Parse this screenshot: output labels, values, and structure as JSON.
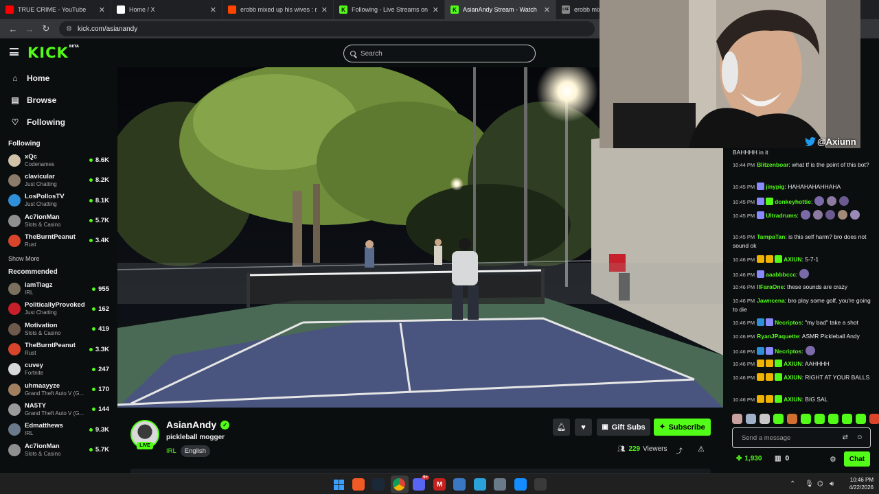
{
  "browser": {
    "tabs": [
      {
        "title": "TRUE CRIME - YouTube",
        "icon": "youtube-icon",
        "color": "#ff0000"
      },
      {
        "title": "Home / X",
        "icon": "x-icon",
        "color": "#ffffff"
      },
      {
        "title": "erobb mixed up his wives : r/Liv",
        "icon": "reddit-icon",
        "color": "#ff4500"
      },
      {
        "title": "Following - Live Streams on Kick",
        "icon": "kick-icon",
        "color": "#53fc18"
      },
      {
        "title": "AsianAndy Stream - Watch",
        "icon": "kick-icon",
        "color": "#53fc18"
      },
      {
        "title": "erobb mixed u",
        "icon": "lsf-icon",
        "color": "#888888"
      }
    ],
    "favicon_letters": {
      "kick": "K",
      "lsf": "LSF"
    },
    "url": "kick.com/asianandy"
  },
  "header": {
    "logo": "KICK",
    "logo_badge": "BETA",
    "search_placeholder": "Search"
  },
  "sidebar": {
    "nav": [
      {
        "label": "Home",
        "icon": "home-icon",
        "glyph": "⌂"
      },
      {
        "label": "Browse",
        "icon": "browse-icon",
        "glyph": "▤"
      },
      {
        "label": "Following",
        "icon": "heart-icon",
        "glyph": "♡"
      }
    ],
    "following_title": "Following",
    "following": [
      {
        "name": "xQc",
        "category": "Codenames",
        "viewers": "8.6K",
        "color": "#d2c3a8"
      },
      {
        "name": "clavicular",
        "category": "Just Chatting",
        "viewers": "8.2K",
        "color": "#8c7a6a"
      },
      {
        "name": "LosPollosTV",
        "category": "Just Chatting",
        "viewers": "8.1K",
        "color": "#2f8fd8"
      },
      {
        "name": "Ac7ionMan",
        "category": "Slots & Casino",
        "viewers": "5.7K",
        "color": "#8f8f8f"
      },
      {
        "name": "TheBurntPeanut",
        "category": "Rust",
        "viewers": "3.4K",
        "color": "#d8452b"
      }
    ],
    "show_more": "Show More",
    "recommended_title": "Recommended",
    "recommended": [
      {
        "name": "iamTiagz",
        "category": "IRL",
        "viewers": "955",
        "color": "#7b6f5e"
      },
      {
        "name": "PoliticallyProvoked",
        "category": "Just Chatting",
        "viewers": "162",
        "color": "#c8202a"
      },
      {
        "name": "Motivation",
        "category": "Slots & Casino",
        "viewers": "419",
        "color": "#6e5a4d"
      },
      {
        "name": "TheBurntPeanut",
        "category": "Rust",
        "viewers": "3.3K",
        "color": "#d8452b"
      },
      {
        "name": "cuvey",
        "category": "Fortnite",
        "viewers": "247",
        "color": "#d8d8d8"
      },
      {
        "name": "uhmaayyze",
        "category": "Grand Theft Auto V (G...",
        "viewers": "170",
        "color": "#a08060"
      },
      {
        "name": "NA5TY",
        "category": "Grand Theft Auto V (G...",
        "viewers": "144",
        "color": "#9a9a9a"
      },
      {
        "name": "Edmatthews",
        "category": "IRL",
        "viewers": "9.3K",
        "color": "#6a7a8a"
      },
      {
        "name": "Ac7ionMan",
        "category": "Slots & Casino",
        "viewers": "5.7K",
        "color": "#8f8f8f"
      }
    ]
  },
  "channel": {
    "name": "AsianAndy",
    "live_label": "LIVE",
    "title": "pickleball mogger",
    "category": "IRL",
    "language": "English",
    "gift_label": "Gift Subs",
    "subscribe_label": "Subscribe",
    "viewer_count": "229",
    "viewers_label": "Viewers"
  },
  "webcam": {
    "handle": "@Axiunn"
  },
  "chat": {
    "messages": [
      {
        "ts": "",
        "user": "",
        "text": "BAHHHH in it",
        "color": "#ececec",
        "badges": []
      },
      {
        "ts": "10:44 PM",
        "user": "Blitzenboar",
        "text": ": what tf is the point of this bot?",
        "color": "#53fc18",
        "badges": []
      },
      {
        "ts": "10:45 PM",
        "user": "jinypig",
        "text": ": HAHAHAHAHHAHA",
        "color": "#53fc18",
        "badges": [
          "#8a8aff"
        ]
      },
      {
        "ts": "10:45 PM",
        "user": "donkeyhottie",
        "text": ":",
        "color": "#53fc18",
        "badges": [
          "#8a8aff",
          "#53fc18"
        ],
        "emotes": 3
      },
      {
        "ts": "10:45 PM",
        "user": "Ultradrums",
        "text": ":",
        "color": "#53fc18",
        "badges": [
          "#8a8aff"
        ],
        "emotes": 5
      },
      {
        "ts": "10:45 PM",
        "user": "TampaTan",
        "text": ": is this self harm? bro does not sound ok",
        "color": "#53fc18",
        "badges": []
      },
      {
        "ts": "10:46 PM",
        "user": "AXIUN",
        "text": ": 5-7-1",
        "color": "#53fc18",
        "badges": [
          "#f0b400",
          "#f0b400",
          "#53fc18"
        ]
      },
      {
        "ts": "10:46 PM",
        "user": "aaabbbccc",
        "text": ":",
        "color": "#53fc18",
        "badges": [
          "#8a8aff"
        ],
        "emotes": 1
      },
      {
        "ts": "10:46 PM",
        "user": "IlFaraOne",
        "text": ": these sounds are crazy",
        "color": "#53fc18",
        "badges": []
      },
      {
        "ts": "10:46 PM",
        "user": "Jawncena",
        "text": ": bro play some golf, you're going to die",
        "color": "#53fc18",
        "badges": []
      },
      {
        "ts": "10:46 PM",
        "user": "Necriptos",
        "text": ": \"my bad\" take a shot",
        "color": "#53fc18",
        "badges": [
          "#2f8fd8",
          "#8a8aff"
        ]
      },
      {
        "ts": "10:46 PM",
        "user": "RyanJPaquette",
        "text": ": ASMR Pickleball Andy",
        "color": "#53fc18",
        "badges": []
      },
      {
        "ts": "10:46 PM",
        "user": "Necriptos",
        "text": ":",
        "color": "#53fc18",
        "badges": [
          "#2f8fd8",
          "#8a8aff"
        ],
        "emotes": 1
      },
      {
        "ts": "10:46 PM",
        "user": "AXIUN",
        "text": ": AAHHHH",
        "color": "#53fc18",
        "badges": [
          "#f0b400",
          "#f0b400",
          "#53fc18"
        ]
      },
      {
        "ts": "10:46 PM",
        "user": "AXIUN",
        "text": ": RIGHT AT YOUR BALLS",
        "color": "#53fc18",
        "badges": [
          "#f0b400",
          "#f0b400",
          "#53fc18"
        ]
      },
      {
        "ts": "10:46 PM",
        "user": "AXIUN",
        "text": ": BIG SAL",
        "color": "#53fc18",
        "badges": [
          "#f0b400",
          "#f0b400",
          "#53fc18"
        ]
      }
    ],
    "emote_bar_colors": [
      "#c8a0a0",
      "#a0b0c8",
      "#c8c8c8",
      "#53fc18",
      "#d07030",
      "#53fc18",
      "#53fc18",
      "#53fc18",
      "#53fc18",
      "#53fc18",
      "#d8452b"
    ],
    "input_placeholder": "Send a message",
    "points": "1,930",
    "points_secondary": "0",
    "chat_button": "Chat"
  },
  "taskbar": {
    "time": "10:46 PM",
    "date": "4/22/2026",
    "icons": [
      {
        "name": "start-icon",
        "color": "#3aa0ff"
      },
      {
        "name": "brave-icon",
        "color": "#f05a24"
      },
      {
        "name": "steam-icon",
        "color": "#1b2838"
      },
      {
        "name": "chrome-icon",
        "color": "#e8b630"
      },
      {
        "name": "discord-icon",
        "color": "#5865f2"
      },
      {
        "name": "gmail-icon",
        "color": "#c5221f"
      },
      {
        "name": "notepad-icon",
        "color": "#3b78c4"
      },
      {
        "name": "telegram-icon",
        "color": "#2aa1da"
      },
      {
        "name": "settings-icon",
        "color": "#6a7a8a"
      },
      {
        "name": "battlenet-icon",
        "color": "#148eff"
      },
      {
        "name": "obs-icon",
        "color": "#3a3a3a"
      }
    ],
    "badge_discord": "9+"
  }
}
